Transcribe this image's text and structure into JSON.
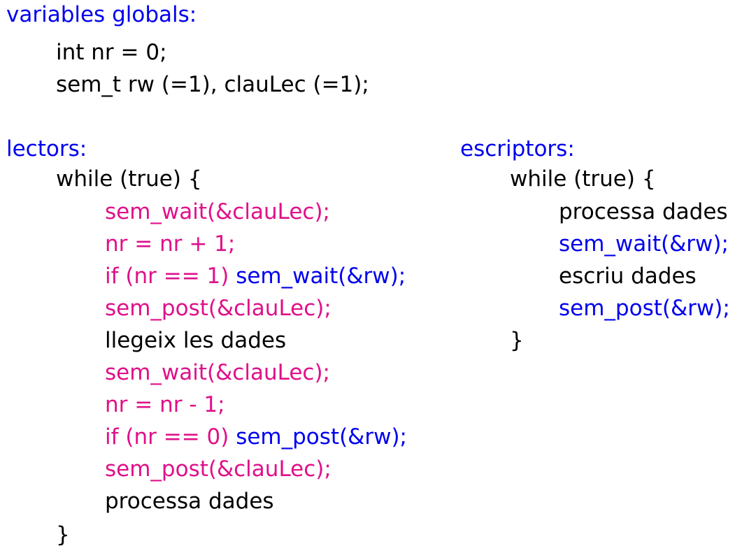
{
  "colors": {
    "heading": "#0000ee",
    "mutex": "#e0108a",
    "semaphore_rw": "#0000ee",
    "text": "#000000"
  },
  "globals": {
    "heading": "variables globals:",
    "line1": "int nr = 0;",
    "line2": "sem_t rw (=1), clauLec (=1);"
  },
  "readers": {
    "heading": "lectors:",
    "loop_open": "while (true) {",
    "l1": "sem_wait(&clauLec);",
    "l2": "nr = nr + 1;",
    "l3a": "if (nr == 1) ",
    "l3b": "sem_wait(&rw);",
    "l4": "sem_post(&clauLec);",
    "l5": "llegeix les dades",
    "l6": "sem_wait(&clauLec);",
    "l7": "nr = nr - 1;",
    "l8a": "if (nr == 0) ",
    "l8b": "sem_post(&rw);",
    "l9": "sem_post(&clauLec);",
    "l10": "processa dades",
    "loop_close": "}"
  },
  "writers": {
    "heading": "escriptors:",
    "loop_open": "while (true) {",
    "l1": "processa dades",
    "l2": "sem_wait(&rw);",
    "l3": "escriu dades",
    "l4": "sem_post(&rw);",
    "loop_close": "}"
  }
}
